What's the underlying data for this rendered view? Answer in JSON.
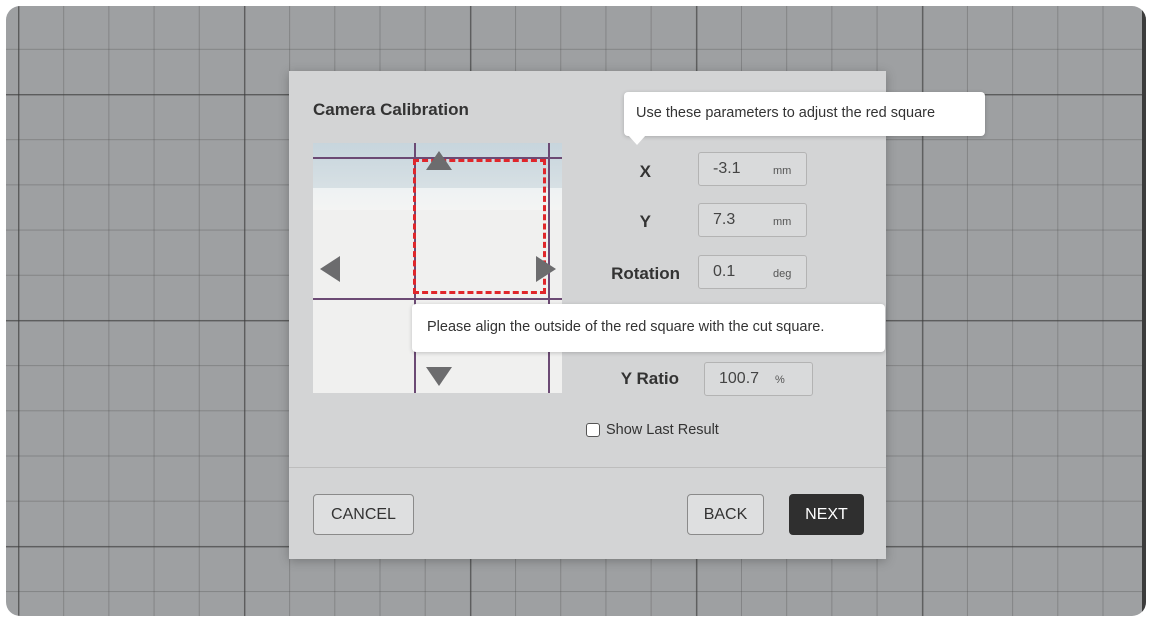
{
  "dialog": {
    "title": "Camera Calibration",
    "params": [
      {
        "key": "x",
        "label": "X",
        "value": "-3.1",
        "unit": "mm"
      },
      {
        "key": "y",
        "label": "Y",
        "value": "7.3",
        "unit": "mm"
      },
      {
        "key": "rotation",
        "label": "Rotation",
        "value": "0.1",
        "unit": "deg"
      },
      {
        "key": "y_ratio",
        "label": "Y Ratio",
        "value": "100.7",
        "unit": "%"
      }
    ],
    "tooltip_params": "Use these parameters to adjust the red square",
    "tooltip_align": "Please align the outside of the red square with the cut square.",
    "show_last_result_label": "Show Last Result",
    "show_last_result_checked": false,
    "buttons": {
      "cancel": "CANCEL",
      "back": "BACK",
      "next": "NEXT"
    }
  },
  "colors": {
    "red_square": "#e0262b",
    "next_button_bg": "#2f2f2f",
    "arrow": "#6c6c6e"
  },
  "icons": {
    "arrow_up": "triangle-up-icon",
    "arrow_down": "triangle-down-icon",
    "arrow_left": "triangle-left-icon",
    "arrow_right": "triangle-right-icon"
  }
}
